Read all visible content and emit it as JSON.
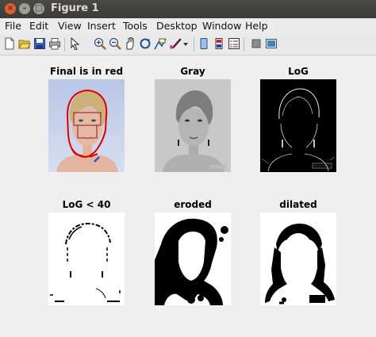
{
  "window": {
    "title": "Figure 1"
  },
  "menu": [
    {
      "key": "file",
      "label": "File"
    },
    {
      "key": "edit",
      "label": "Edit"
    },
    {
      "key": "view",
      "label": "View"
    },
    {
      "key": "insert",
      "label": "Insert"
    },
    {
      "key": "tools",
      "label": "Tools"
    },
    {
      "key": "desktop",
      "label": "Desktop"
    },
    {
      "key": "window",
      "label": "Window"
    },
    {
      "key": "help",
      "label": "Help"
    }
  ],
  "toolbar": {
    "icons": [
      "new-figure-icon",
      "open-file-icon",
      "save-icon",
      "print-icon",
      "zoom-in-icon",
      "zoom-out-icon",
      "pan-icon",
      "rotate-3d-icon",
      "data-cursor-icon",
      "brush-icon",
      "brush-dropdown-icon",
      "link-plot-icon",
      "insert-colorbar-icon",
      "insert-legend-icon",
      "hide-plot-tools-icon",
      "show-plot-tools-icon"
    ]
  },
  "panels": [
    {
      "title": "Final is in red"
    },
    {
      "title": "Gray"
    },
    {
      "title": "LoG"
    },
    {
      "title": "LoG < 40"
    },
    {
      "title": "eroded"
    },
    {
      "title": "dilated"
    }
  ],
  "colors": {
    "titlebar": "#3c3b37",
    "close": "#e35b2f",
    "outline": "#e00000",
    "box": "#8b1a1a"
  }
}
